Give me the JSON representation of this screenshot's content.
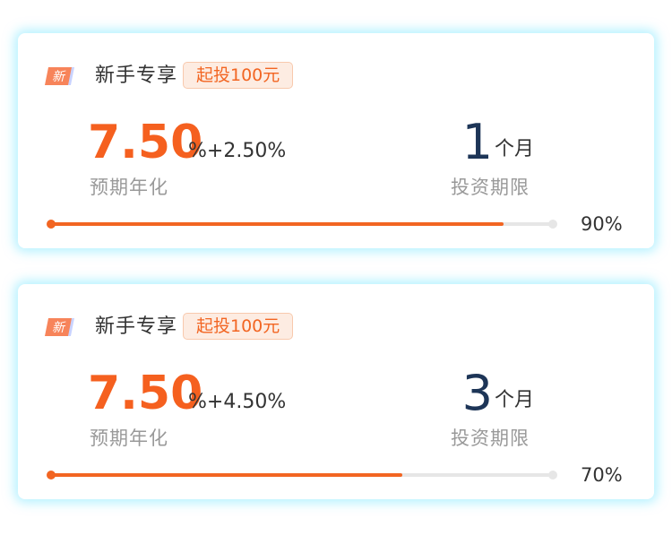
{
  "colors": {
    "accent": "#f5601f",
    "term_number": "#1d3557",
    "label_gray": "#999999",
    "card_glow": "#78e6ff"
  },
  "products": [
    {
      "badge_text": "新",
      "name": "新手专享",
      "min_invest_tag": "起投100元",
      "rate": "7.50",
      "rate_extra": "%+2.50%",
      "rate_label": "预期年化",
      "term_value": "1",
      "term_unit": "个月",
      "term_label": "投资期限",
      "progress_percent": 90,
      "progress_text": "90%"
    },
    {
      "badge_text": "新",
      "name": "新手专享",
      "min_invest_tag": "起投100元",
      "rate": "7.50",
      "rate_extra": "%+4.50%",
      "rate_label": "预期年化",
      "term_value": "3",
      "term_unit": "个月",
      "term_label": "投资期限",
      "progress_percent": 70,
      "progress_text": "70%"
    }
  ]
}
